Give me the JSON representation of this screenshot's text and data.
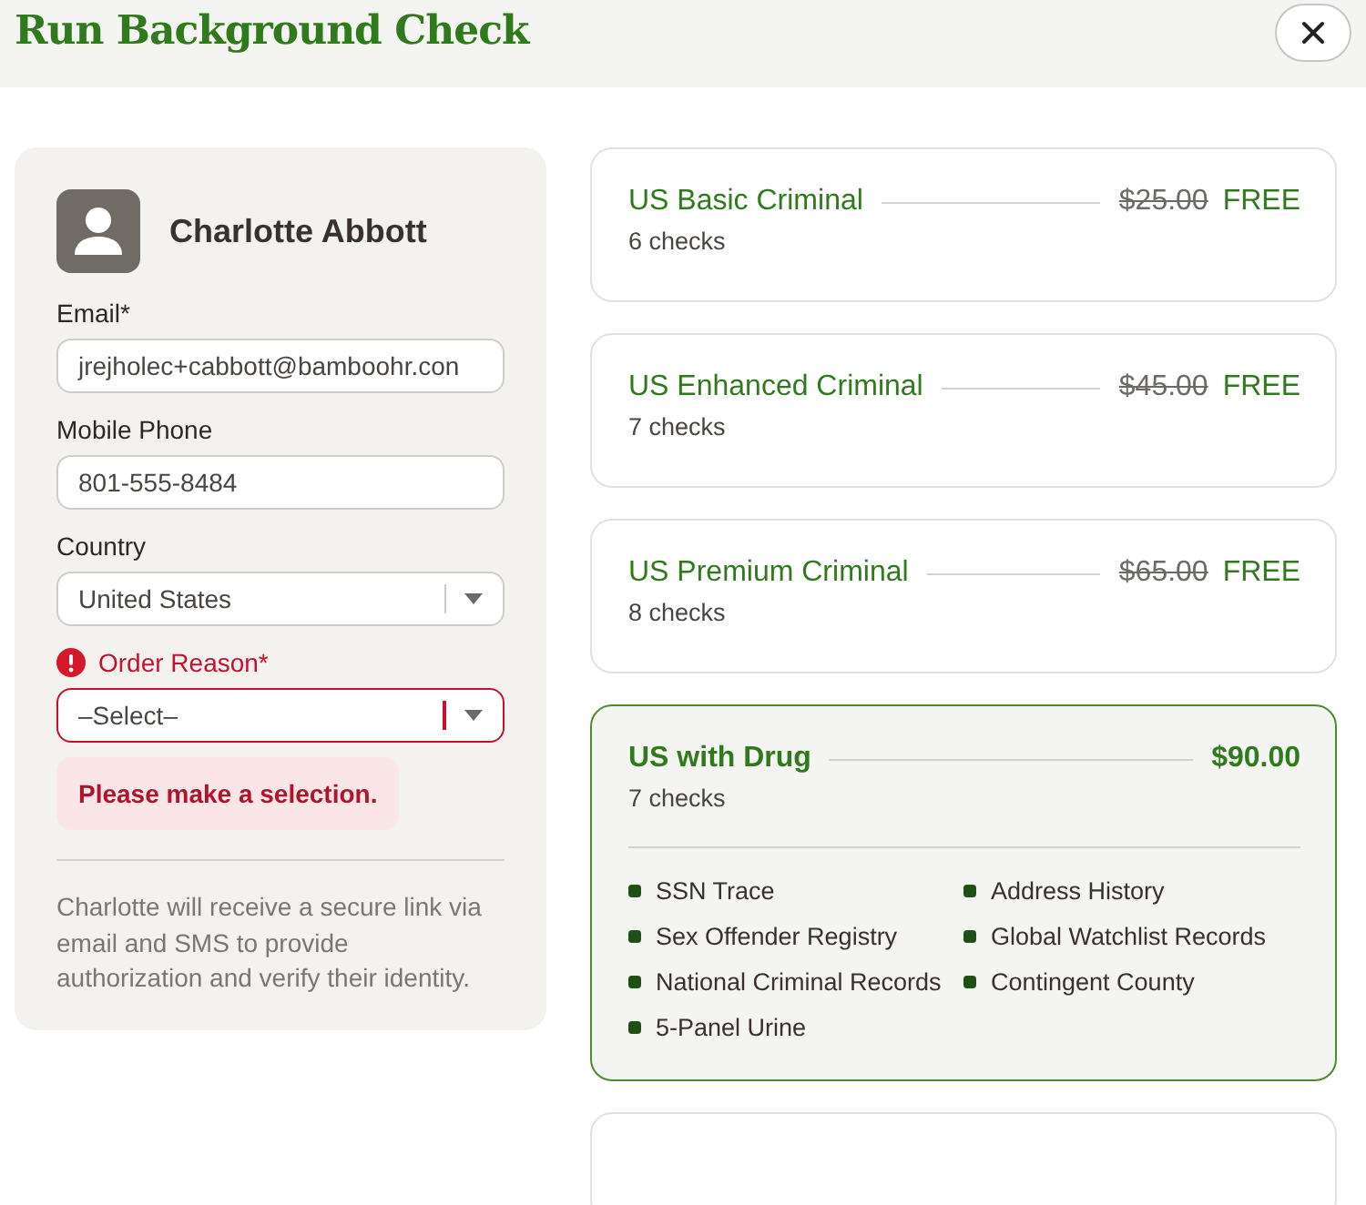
{
  "window": {
    "title": "Run Background Check"
  },
  "person": {
    "name": "Charlotte Abbott"
  },
  "fields": [
    {
      "kind": "text",
      "label": "Email*",
      "value": "jrejholec+cabbott@bamboohr.con",
      "error": false
    },
    {
      "kind": "text",
      "label": "Mobile Phone",
      "value": "801-555-8484",
      "error": false
    },
    {
      "kind": "select",
      "label": "Country",
      "value": "United States",
      "error": false
    },
    {
      "kind": "select",
      "label": "Order Reason*",
      "value": "–Select–",
      "error": true,
      "error_message": "Please make a selection."
    }
  ],
  "note": "Charlotte will receive a secure link via email and SMS to provide authorization and verify their identity.",
  "packages": [
    {
      "name": "US Basic Criminal",
      "checks": "6 checks",
      "original_price": "$25.00",
      "price": "FREE",
      "selected": false
    },
    {
      "name": "US Enhanced Criminal",
      "checks": "7 checks",
      "original_price": "$45.00",
      "price": "FREE",
      "selected": false
    },
    {
      "name": "US Premium Criminal",
      "checks": "8 checks",
      "original_price": "$65.00",
      "price": "FREE",
      "selected": false
    },
    {
      "name": "US with Drug",
      "checks": "7 checks",
      "price": "$90.00",
      "selected": true,
      "items": [
        "SSN Trace",
        "Address History",
        "Sex Offender Registry",
        "Global Watchlist Records",
        "National Criminal Records",
        "Contingent County",
        "5-Panel Urine"
      ]
    }
  ]
}
